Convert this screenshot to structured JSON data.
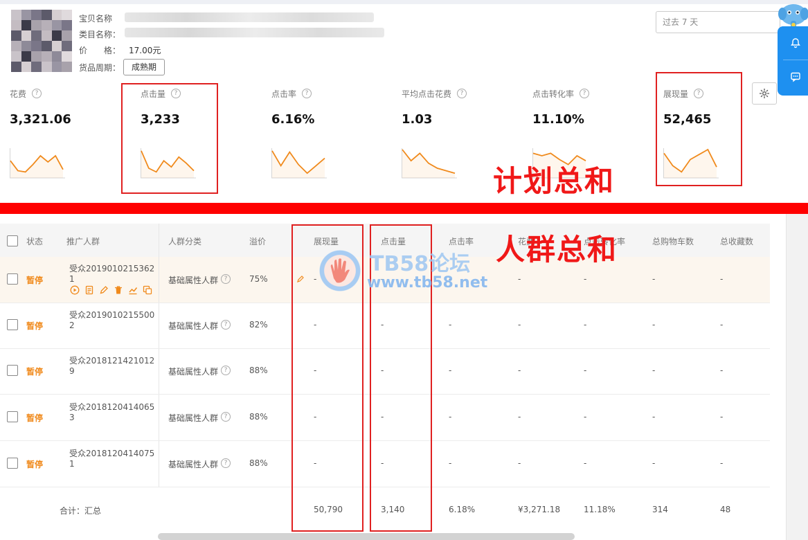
{
  "product": {
    "name_label": "宝贝名称",
    "category_label": "类目名称：",
    "price_label": "价　　格：",
    "price_value": "17.00元",
    "period_label": "货品周期：",
    "period_button": "成熟期"
  },
  "date_range": {
    "value": "过去 7 天"
  },
  "metrics": [
    {
      "label": "花费",
      "value": "3,321.06",
      "trend": [
        0.55,
        0.15,
        0.1,
        0.4,
        0.75,
        0.5,
        0.75,
        0.2
      ]
    },
    {
      "label": "点击量",
      "value": "3,233",
      "trend": [
        0.95,
        0.25,
        0.1,
        0.55,
        0.3,
        0.7,
        0.45,
        0.15
      ]
    },
    {
      "label": "点击率",
      "value": "6.16%",
      "trend": [
        0.95,
        0.35,
        0.9,
        0.4,
        0.05,
        0.35,
        0.65
      ]
    },
    {
      "label": "平均点击花费",
      "value": "1.03",
      "trend": [
        1.0,
        0.55,
        0.85,
        0.45,
        0.25,
        0.15,
        0.05
      ]
    },
    {
      "label": "点击转化率",
      "value": "11.10%",
      "trend": [
        0.85,
        0.75,
        0.85,
        0.6,
        0.4,
        0.75,
        0.55
      ]
    },
    {
      "label": "展现量",
      "value": "52,465",
      "trend": [
        0.85,
        0.35,
        0.1,
        0.6,
        0.8,
        1.0,
        0.3
      ]
    }
  ],
  "annotations": {
    "plan_total": "计划总和",
    "crowd_total": "人群总和"
  },
  "watermark": {
    "title": "TB58论坛",
    "url": "www.tb58.net"
  },
  "table": {
    "headers": {
      "status": "状态",
      "crowd": "推广人群",
      "category": "人群分类",
      "premium": "溢价",
      "impressions": "展现量",
      "clicks": "点击量",
      "ctr": "点击率",
      "cost": "花费",
      "conv": "点击转化率",
      "carts": "总购物车数",
      "favs": "总收藏数"
    },
    "rows": [
      {
        "status": "暂停",
        "name_line1": "受众2019010215362",
        "name_line2": "1",
        "category": "基础属性人群",
        "premium": "75%",
        "impressions": "-",
        "clicks": "-",
        "ctr": "-",
        "cost": "-",
        "conv": "-",
        "carts": "-",
        "favs": "-"
      },
      {
        "status": "暂停",
        "name_line1": "受众2019010215500",
        "name_line2": "2",
        "category": "基础属性人群",
        "premium": "82%",
        "impressions": "-",
        "clicks": "-",
        "ctr": "-",
        "cost": "-",
        "conv": "-",
        "carts": "-",
        "favs": "-"
      },
      {
        "status": "暂停",
        "name_line1": "受众2018121421012",
        "name_line2": "9",
        "category": "基础属性人群",
        "premium": "88%",
        "impressions": "-",
        "clicks": "-",
        "ctr": "-",
        "cost": "-",
        "conv": "-",
        "carts": "-",
        "favs": "-"
      },
      {
        "status": "暂停",
        "name_line1": "受众2018120414065",
        "name_line2": "3",
        "category": "基础属性人群",
        "premium": "88%",
        "impressions": "-",
        "clicks": "-",
        "ctr": "-",
        "cost": "-",
        "conv": "-",
        "carts": "-",
        "favs": "-"
      },
      {
        "status": "暂停",
        "name_line1": "受众2018120414075",
        "name_line2": "1",
        "category": "基础属性人群",
        "premium": "88%",
        "impressions": "-",
        "clicks": "-",
        "ctr": "-",
        "cost": "-",
        "conv": "-",
        "carts": "-",
        "favs": "-"
      }
    ],
    "total": {
      "label": "合计：汇总",
      "impressions": "50,790",
      "clicks": "3,140",
      "ctr": "6.18%",
      "cost": "¥3,271.18",
      "conv": "11.18%",
      "carts": "314",
      "favs": "48"
    }
  },
  "colors": {
    "accent": "#1e90f0",
    "trend": "#f08a1c",
    "status": "#f08a1c",
    "annotation": "#f01818"
  },
  "icons": [
    "bell-icon",
    "chat-icon",
    "gear-icon",
    "help-icon",
    "pencil-icon",
    "play-icon",
    "report-icon",
    "edit-icon",
    "delete-icon",
    "trend-icon",
    "copy-icon",
    "mascot-icon"
  ]
}
